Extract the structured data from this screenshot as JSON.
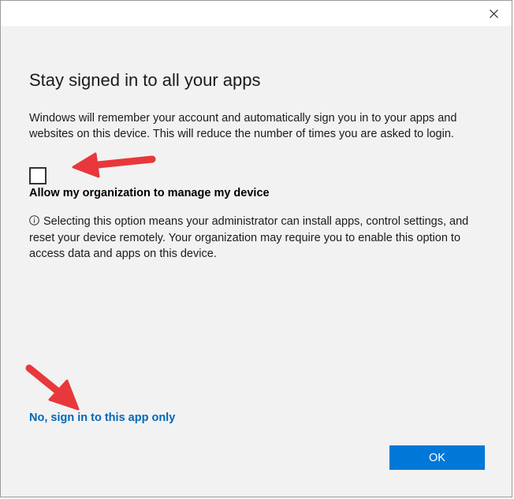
{
  "dialog": {
    "title": "Stay signed in to all your apps",
    "description": "Windows will remember your account and automatically sign you in to your apps and websites on this device. This will reduce the number of times you are asked to login.",
    "checkbox": {
      "checked": false,
      "label": "Allow my organization to manage my device"
    },
    "info_text": "Selecting this option means your administrator can install apps, control settings, and reset your device remotely. Your organization may require you to enable this option to access data and apps on this device.",
    "info_icon": "info-circle-icon",
    "link_label": "No, sign in to this app only",
    "ok_label": "OK"
  },
  "titlebar": {
    "close_icon": "close-icon"
  },
  "annotations": {
    "arrow_color": "#e8383c",
    "arrows": [
      "arrow-pointing-to-checkbox",
      "arrow-pointing-to-link"
    ]
  },
  "colors": {
    "background": "#f2f2f2",
    "link": "#0067b8",
    "button": "#0078d7"
  }
}
